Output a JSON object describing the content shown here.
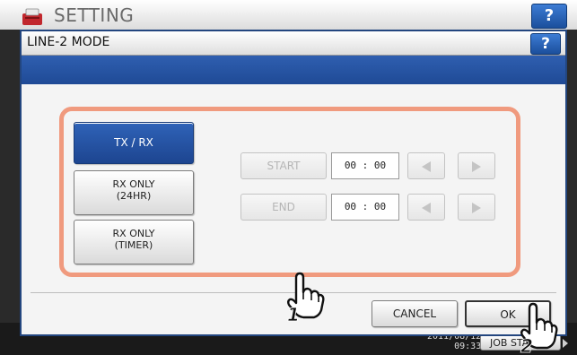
{
  "background": {
    "title": "SETTING",
    "help_label": "?",
    "clock_date": "2011/08/12",
    "clock_time": "09:33",
    "jobs_label": "JOB STATUS"
  },
  "modal": {
    "title": "LINE-2 MODE",
    "help_label": "?"
  },
  "modes": [
    {
      "label": "TX / RX",
      "selected": true
    },
    {
      "label": "RX ONLY",
      "sub": "(24HR)",
      "selected": false
    },
    {
      "label": "RX ONLY",
      "sub": "(TIMER)",
      "selected": false
    }
  ],
  "timer": {
    "start_label": "START",
    "start_value": "00 : 00",
    "end_label": "END",
    "end_value": "00 : 00"
  },
  "actions": {
    "cancel_label": "CANCEL",
    "ok_label": "OK"
  },
  "callouts": {
    "step1": "1",
    "step2": "2"
  },
  "colors": {
    "accent_blue": "#1f4a96",
    "selected_button": "#2f63b8",
    "highlight_frame": "#f09a7e"
  }
}
